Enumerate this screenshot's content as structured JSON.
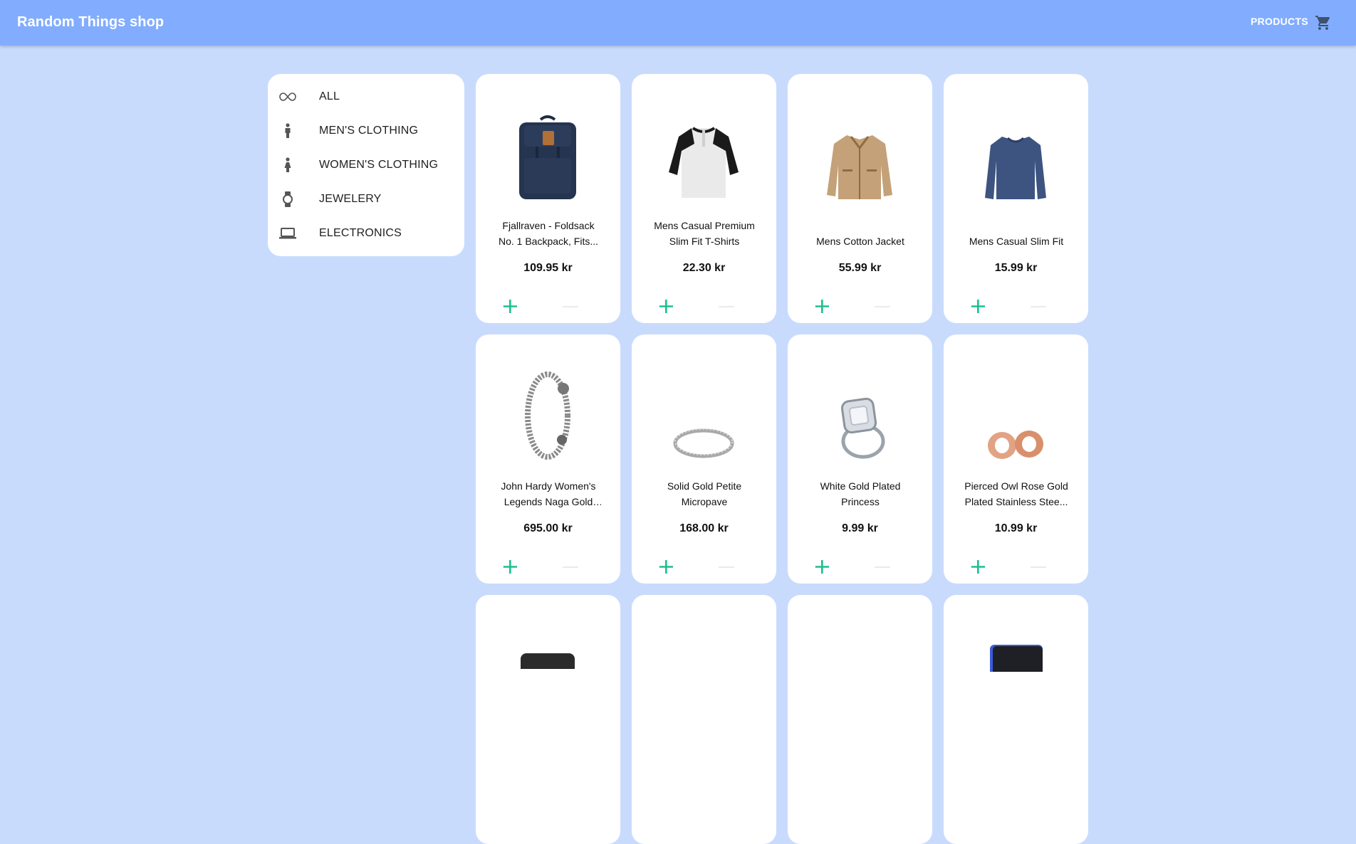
{
  "header": {
    "title": "Random Things shop",
    "nav_products": "PRODUCTS",
    "cart_icon": "shopping-cart-icon",
    "color": "#82adfe"
  },
  "sidebar": {
    "items": [
      {
        "label": "ALL",
        "icon": "infinity-icon"
      },
      {
        "label": "MEN'S CLOTHING",
        "icon": "man-icon"
      },
      {
        "label": "WOMEN'S CLOTHING",
        "icon": "woman-icon"
      },
      {
        "label": "JEWELERY",
        "icon": "watch-icon"
      },
      {
        "label": "ELECTRONICS",
        "icon": "laptop-icon"
      }
    ]
  },
  "products": [
    {
      "name": "Fjallraven - Foldsack No. 1 Backpack, Fits...",
      "price": "109.95 kr",
      "image": "backpack"
    },
    {
      "name": "Mens Casual Premium Slim Fit T-Shirts",
      "price": "22.30 kr",
      "image": "henley-shirt"
    },
    {
      "name": "Mens Cotton Jacket",
      "price": "55.99 kr",
      "image": "jacket"
    },
    {
      "name": "Mens Casual Slim Fit",
      "price": "15.99 kr",
      "image": "sweater"
    },
    {
      "name": "John Hardy Women's Legends Naga Gold &...",
      "price": "695.00 kr",
      "image": "bracelet"
    },
    {
      "name": "Solid Gold Petite Micropave",
      "price": "168.00 kr",
      "image": "ring"
    },
    {
      "name": "White Gold Plated Princess",
      "price": "9.99 kr",
      "image": "diamond-ring"
    },
    {
      "name": "Pierced Owl Rose Gold Plated Stainless Stee...",
      "price": "10.99 kr",
      "image": "plugs"
    },
    {
      "name": "",
      "price": "",
      "image": "hard-drive"
    },
    {
      "name": "",
      "price": "",
      "image": ""
    },
    {
      "name": "",
      "price": "",
      "image": ""
    },
    {
      "name": "",
      "price": "",
      "image": "ssd"
    }
  ],
  "colors": {
    "background": "#c9dbfd",
    "add_button": "#1bbf8f"
  }
}
